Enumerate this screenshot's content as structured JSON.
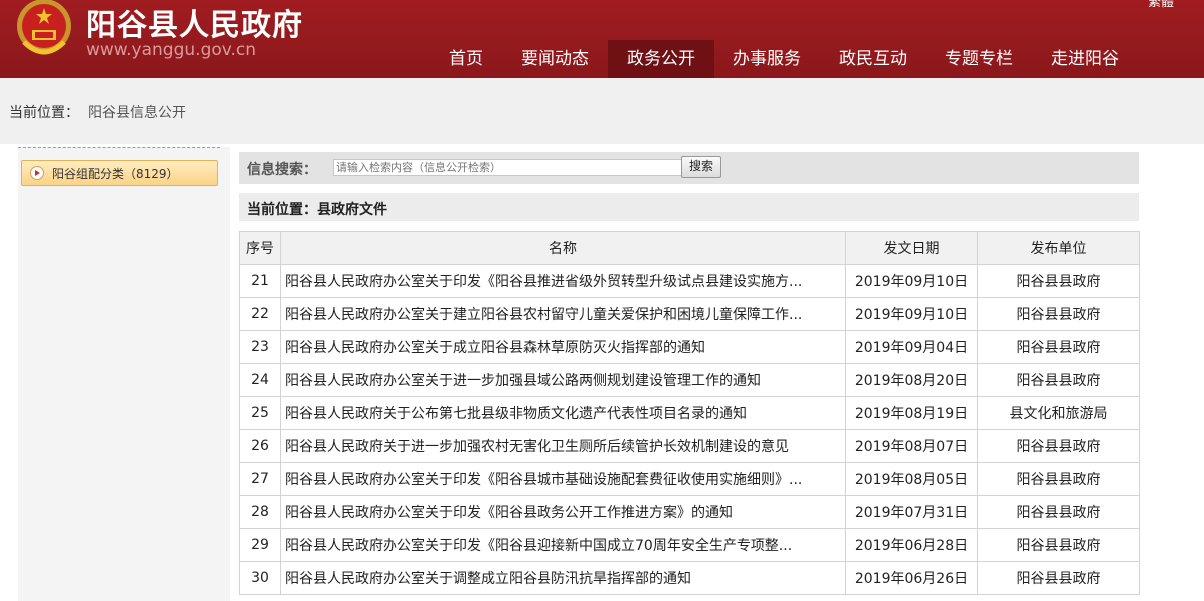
{
  "header": {
    "title": "阳谷县人民政府",
    "url": "www.yanggu.gov.cn",
    "corner_text": "繁體",
    "nav": [
      {
        "label": "首页",
        "active": false
      },
      {
        "label": "要闻动态",
        "active": false
      },
      {
        "label": "政务公开",
        "active": true
      },
      {
        "label": "办事服务",
        "active": false
      },
      {
        "label": "政民互动",
        "active": false
      },
      {
        "label": "专题专栏",
        "active": false
      },
      {
        "label": "走进阳谷",
        "active": false
      }
    ]
  },
  "breadcrumb": {
    "label": "当前位置：",
    "value": "阳谷县信息公开"
  },
  "sidebar": {
    "item_label": "阳谷组配分类（8129）"
  },
  "search": {
    "label": "信息搜索：",
    "placeholder": "请输入检索内容（信息公开检索）",
    "button": "搜索"
  },
  "section": {
    "title": "当前位置：县政府文件"
  },
  "table": {
    "headers": [
      "序号",
      "名称",
      "发文日期",
      "发布单位"
    ],
    "rows": [
      {
        "no": "21",
        "name": "阳谷县人民政府办公室关于印发《阳谷县推进省级外贸转型升级试点县建设实施方...",
        "date": "2019年09月10日",
        "unit": "阳谷县县政府"
      },
      {
        "no": "22",
        "name": "阳谷县人民政府办公室关于建立阳谷县农村留守儿童关爱保护和困境儿童保障工作...",
        "date": "2019年09月10日",
        "unit": "阳谷县县政府"
      },
      {
        "no": "23",
        "name": "阳谷县人民政府办公室关于成立阳谷县森林草原防灭火指挥部的通知",
        "date": "2019年09月04日",
        "unit": "阳谷县县政府"
      },
      {
        "no": "24",
        "name": "阳谷县人民政府办公室关于进一步加强县域公路两侧规划建设管理工作的通知",
        "date": "2019年08月20日",
        "unit": "阳谷县县政府"
      },
      {
        "no": "25",
        "name": "阳谷县人民政府关于公布第七批县级非物质文化遗产代表性项目名录的通知",
        "date": "2019年08月19日",
        "unit": "县文化和旅游局"
      },
      {
        "no": "26",
        "name": "阳谷县人民政府关于进一步加强农村无害化卫生厕所后续管护长效机制建设的意见",
        "date": "2019年08月07日",
        "unit": "阳谷县县政府"
      },
      {
        "no": "27",
        "name": "阳谷县人民政府办公室关于印发《阳谷县城市基础设施配套费征收使用实施细则》...",
        "date": "2019年08月05日",
        "unit": "阳谷县县政府"
      },
      {
        "no": "28",
        "name": "阳谷县人民政府办公室关于印发《阳谷县政务公开工作推进方案》的通知",
        "date": "2019年07月31日",
        "unit": "阳谷县县政府"
      },
      {
        "no": "29",
        "name": "阳谷县人民政府办公室关于印发《阳谷县迎接新中国成立70周年安全生产专项整...",
        "date": "2019年06月28日",
        "unit": "阳谷县县政府"
      },
      {
        "no": "30",
        "name": "阳谷县人民政府办公室关于调整成立阳谷县防汛抗旱指挥部的通知",
        "date": "2019年06月26日",
        "unit": "阳谷县县政府"
      }
    ]
  },
  "colors": {
    "header_red": "#a01c20",
    "nav_active": "#6e1014"
  }
}
